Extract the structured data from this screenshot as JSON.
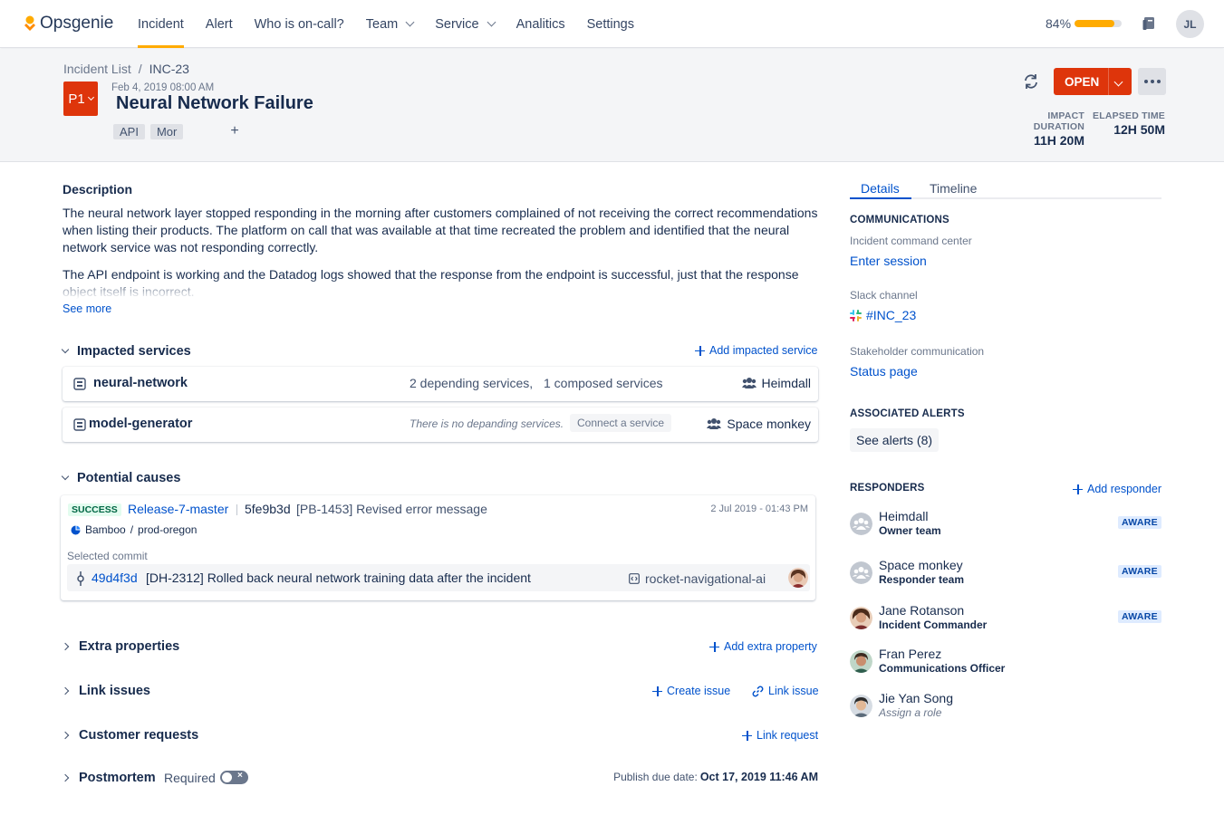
{
  "nav": {
    "brand": "Opsgenie",
    "items": [
      {
        "label": "Incident",
        "active": true,
        "dropdown": false
      },
      {
        "label": "Alert",
        "active": false,
        "dropdown": false
      },
      {
        "label": "Who is on-call?",
        "active": false,
        "dropdown": false
      },
      {
        "label": "Team",
        "active": false,
        "dropdown": true
      },
      {
        "label": "Service",
        "active": false,
        "dropdown": true
      },
      {
        "label": "Analitics",
        "active": false,
        "dropdown": false
      },
      {
        "label": "Settings",
        "active": false,
        "dropdown": false
      }
    ],
    "progress_label": "84%",
    "progress_value": 0.84,
    "user_initials": "JL"
  },
  "header": {
    "breadcrumb": [
      "Incident List",
      "INC-23"
    ],
    "priority": "P1",
    "date": "Feb 4, 2019 08:00 AM",
    "title": "Neural Network Failure",
    "tags": [
      "API",
      "Mor"
    ],
    "tag_add": "+",
    "status_button": "OPEN",
    "impact_duration_label": "IMPACT DURATION",
    "impact_duration": "11H 20M",
    "elapsed_time_label": "ELAPSED TIME",
    "elapsed_time": "12H 50M"
  },
  "description": {
    "title": "Description",
    "p1": "The neural network layer stopped responding in the morning after customers complained of not receiving the correct recommendations when listing their products. The platform on call that was available at that time recreated the problem and identified that the neural network service was not responding correctly.",
    "p2": "The API endpoint is working and the Datadog logs showed that the response from the endpoint is successful, just that the response object itself is incorrect.",
    "see_more": "See more"
  },
  "impacted_services": {
    "title": "Impacted services",
    "action": "Add impacted service",
    "items": [
      {
        "name": "neural-network",
        "deps": "2 depending services,",
        "composed": "1 composed services",
        "team": "Heimdall"
      },
      {
        "name": "model-generator",
        "no_deps": "There is no depanding services.",
        "connect": "Connect a service",
        "team": "Space monkey"
      }
    ]
  },
  "potential_causes": {
    "title": "Potential causes",
    "status": "SUCCESS",
    "release": "Release-7-master",
    "hash": "5fe9b3d",
    "message": "[PB-1453] Revised error message",
    "date": "2 Jul 2019 - 01:43 PM",
    "source": "Bamboo",
    "env": "prod-oregon",
    "selected_label": "Selected commit",
    "commit_hash": "49d4f3d",
    "commit_text": "[DH-2312] Rolled back neural network training data after the incident",
    "repo": "rocket-navigational-ai"
  },
  "sections": {
    "extra": {
      "title": "Extra properties",
      "action": "Add extra property"
    },
    "link_issues": {
      "title": "Link issues",
      "create": "Create issue",
      "link": "Link issue"
    },
    "customer": {
      "title": "Customer requests",
      "action": "Link request"
    },
    "postmortem": {
      "title": "Postmortem",
      "required": "Required",
      "due_label": "Publish due date:",
      "due_value": "Oct 17, 2019 11:46 AM"
    }
  },
  "panel": {
    "tabs": [
      "Details",
      "Timeline"
    ],
    "comms_title": "COMMUNICATIONS",
    "icc_label": "Incident command center",
    "icc_link": "Enter session",
    "slack_label": "Slack channel",
    "slack_link": "#INC_23",
    "stake_label": "Stakeholder communication",
    "stake_link": "Status page",
    "alerts_title": "ASSOCIATED ALERTS",
    "alerts_button": "See alerts (8)",
    "responders_title": "RESPONDERS",
    "add_responder": "Add responder",
    "responders": [
      {
        "name": "Heimdall",
        "role": "Owner team",
        "badge": "AWARE"
      },
      {
        "name": "Space monkey",
        "role": "Responder team",
        "badge": "AWARE"
      },
      {
        "name": "Jane Rotanson",
        "role": "Incident Commander",
        "badge": "AWARE"
      },
      {
        "name": "Fran Perez",
        "role": "Communications Officer"
      },
      {
        "name": "Jie Yan Song",
        "role": "Assign a role"
      }
    ]
  },
  "colors": {
    "accent": "#0052CC",
    "danger": "#DE350B",
    "warning": "#FFAB00",
    "success_bg": "#E3FCEF"
  }
}
